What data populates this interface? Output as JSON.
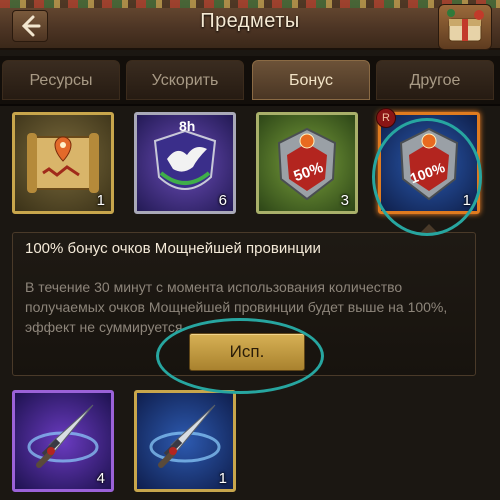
{
  "header": {
    "title": "Предметы",
    "back_icon": "back-arrow-icon",
    "gift_icon": "gift-chest-icon"
  },
  "tabs": [
    {
      "label": "Ресурсы",
      "active": false
    },
    {
      "label": "Ускорить",
      "active": false
    },
    {
      "label": "Бонус",
      "active": true
    },
    {
      "label": "Другое",
      "active": false
    }
  ],
  "items": [
    {
      "icon": "map-scroll-icon",
      "count": "1"
    },
    {
      "icon": "dove-shield-icon",
      "count": "6",
      "badge": "8h"
    },
    {
      "icon": "shield-50-icon",
      "count": "3",
      "badge": "50%"
    },
    {
      "icon": "shield-100-icon",
      "count": "1",
      "badge": "100%",
      "selected": true
    },
    {
      "icon": "sword-purple-icon",
      "count": "4"
    },
    {
      "icon": "sword-blue-icon",
      "count": "1"
    }
  ],
  "detail": {
    "title": "100% бонус очков Мощнейшей провинции",
    "description": "В течение 30 минут с момента использования количество получаемых очков Мощнейшей провинции будет выше на 100%, эффект не суммируется",
    "use_button": "Исп."
  },
  "colors": {
    "accent_gold": "#c8a64c",
    "annotation": "#27a6a0"
  }
}
